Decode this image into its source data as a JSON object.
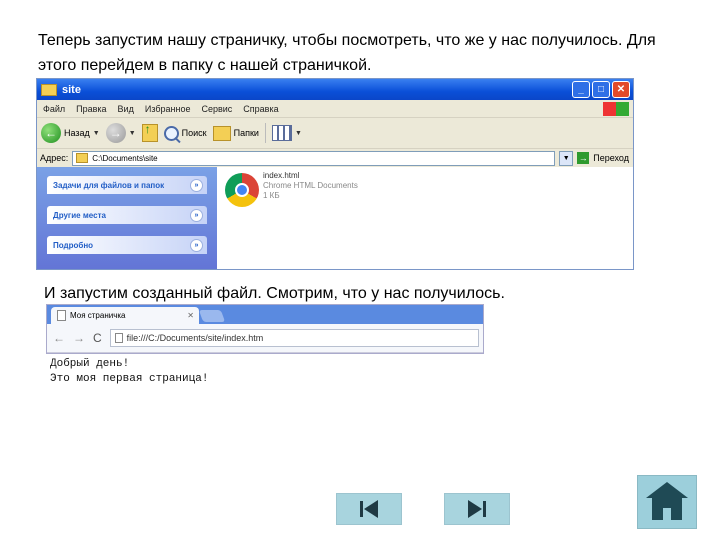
{
  "slide": {
    "paragraph1": "Теперь запустим нашу страничку, чтобы посмотреть, что же у нас получилось. Для этого перейдем в папку с нашей страничкой.",
    "paragraph2": "И запустим созданный файл. Смотрим, что у нас получилось."
  },
  "explorer": {
    "title": "site",
    "menu": [
      "Файл",
      "Правка",
      "Вид",
      "Избранное",
      "Сервис",
      "Справка"
    ],
    "toolbar": {
      "back": "Назад",
      "search": "Поиск",
      "folders": "Папки"
    },
    "address_label": "Адрес:",
    "address_value": "C:\\Documents\\site",
    "go_label": "Переход",
    "panels": [
      "Задачи для файлов и папок",
      "Другие места",
      "Подробно"
    ],
    "file": {
      "name": "index.html",
      "type": "Chrome HTML Documents",
      "size": "1 КБ"
    }
  },
  "browser": {
    "tab_title": "Моя страничка",
    "url": "file:///C:/Documents/site/index.htm",
    "page_lines": [
      "Добрый день!",
      "Это моя первая страница!"
    ]
  },
  "colors": {
    "nav_button": "#a8d4de",
    "xp_title": "#0a4fd8"
  }
}
